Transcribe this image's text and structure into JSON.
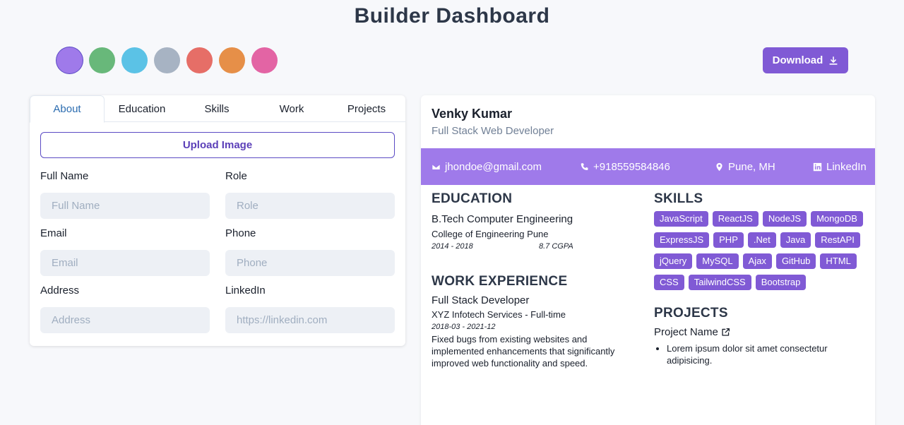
{
  "page": {
    "title": "Builder Dashboard"
  },
  "theme": {
    "swatches": [
      "#9f7aea",
      "#68b87a",
      "#5bc2e6",
      "#a7b3c3",
      "#e66e67",
      "#e68f48",
      "#e364a4"
    ],
    "selected_index": 0,
    "accent": "#805ad5"
  },
  "toolbar": {
    "download_label": "Download"
  },
  "editor": {
    "tabs": [
      {
        "label": "About"
      },
      {
        "label": "Education"
      },
      {
        "label": "Skills"
      },
      {
        "label": "Work"
      },
      {
        "label": "Projects"
      }
    ],
    "active_tab": "About",
    "upload_label": "Upload Image",
    "fields": {
      "full_name": {
        "label": "Full Name",
        "placeholder": "Full Name",
        "value": ""
      },
      "role": {
        "label": "Role",
        "placeholder": "Role",
        "value": ""
      },
      "email": {
        "label": "Email",
        "placeholder": "Email",
        "value": ""
      },
      "phone": {
        "label": "Phone",
        "placeholder": "Phone",
        "value": ""
      },
      "address": {
        "label": "Address",
        "placeholder": "Address",
        "value": ""
      },
      "linkedin": {
        "label": "LinkedIn",
        "placeholder": "https://linkedin.com",
        "value": ""
      }
    }
  },
  "resume": {
    "name": "Venky Kumar",
    "role": "Full Stack Web Developer",
    "contact": {
      "email": "jhondoe@gmail.com",
      "phone": "+918559584846",
      "location": "Pune, MH",
      "linkedin": "LinkedIn"
    },
    "education": {
      "heading": "EDUCATION",
      "degree": "B.Tech Computer Engineering",
      "institute": "College of Engineering Pune",
      "period": "2014 - 2018",
      "grade": "8.7 CGPA"
    },
    "work": {
      "heading": "WORK EXPERIENCE",
      "title": "Full Stack Developer",
      "company": "XYZ Infotech Services - Full-time",
      "period": "2018-03 - 2021-12",
      "description": "Fixed bugs from existing websites and implemented enhancements that significantly improved web functionality and speed."
    },
    "skills": {
      "heading": "SKILLS",
      "items": [
        "JavaScript",
        "ReactJS",
        "NodeJS",
        "MongoDB",
        "ExpressJS",
        "PHP",
        ".Net",
        "Java",
        "RestAPI",
        "jQuery",
        "MySQL",
        "Ajax",
        "GitHub",
        "HTML",
        "CSS",
        "TailwindCSS",
        "Bootstrap"
      ]
    },
    "projects": {
      "heading": "PROJECTS",
      "name": "Project Name",
      "points": [
        "Lorem ipsum dolor sit amet consectetur adipisicing."
      ]
    }
  }
}
